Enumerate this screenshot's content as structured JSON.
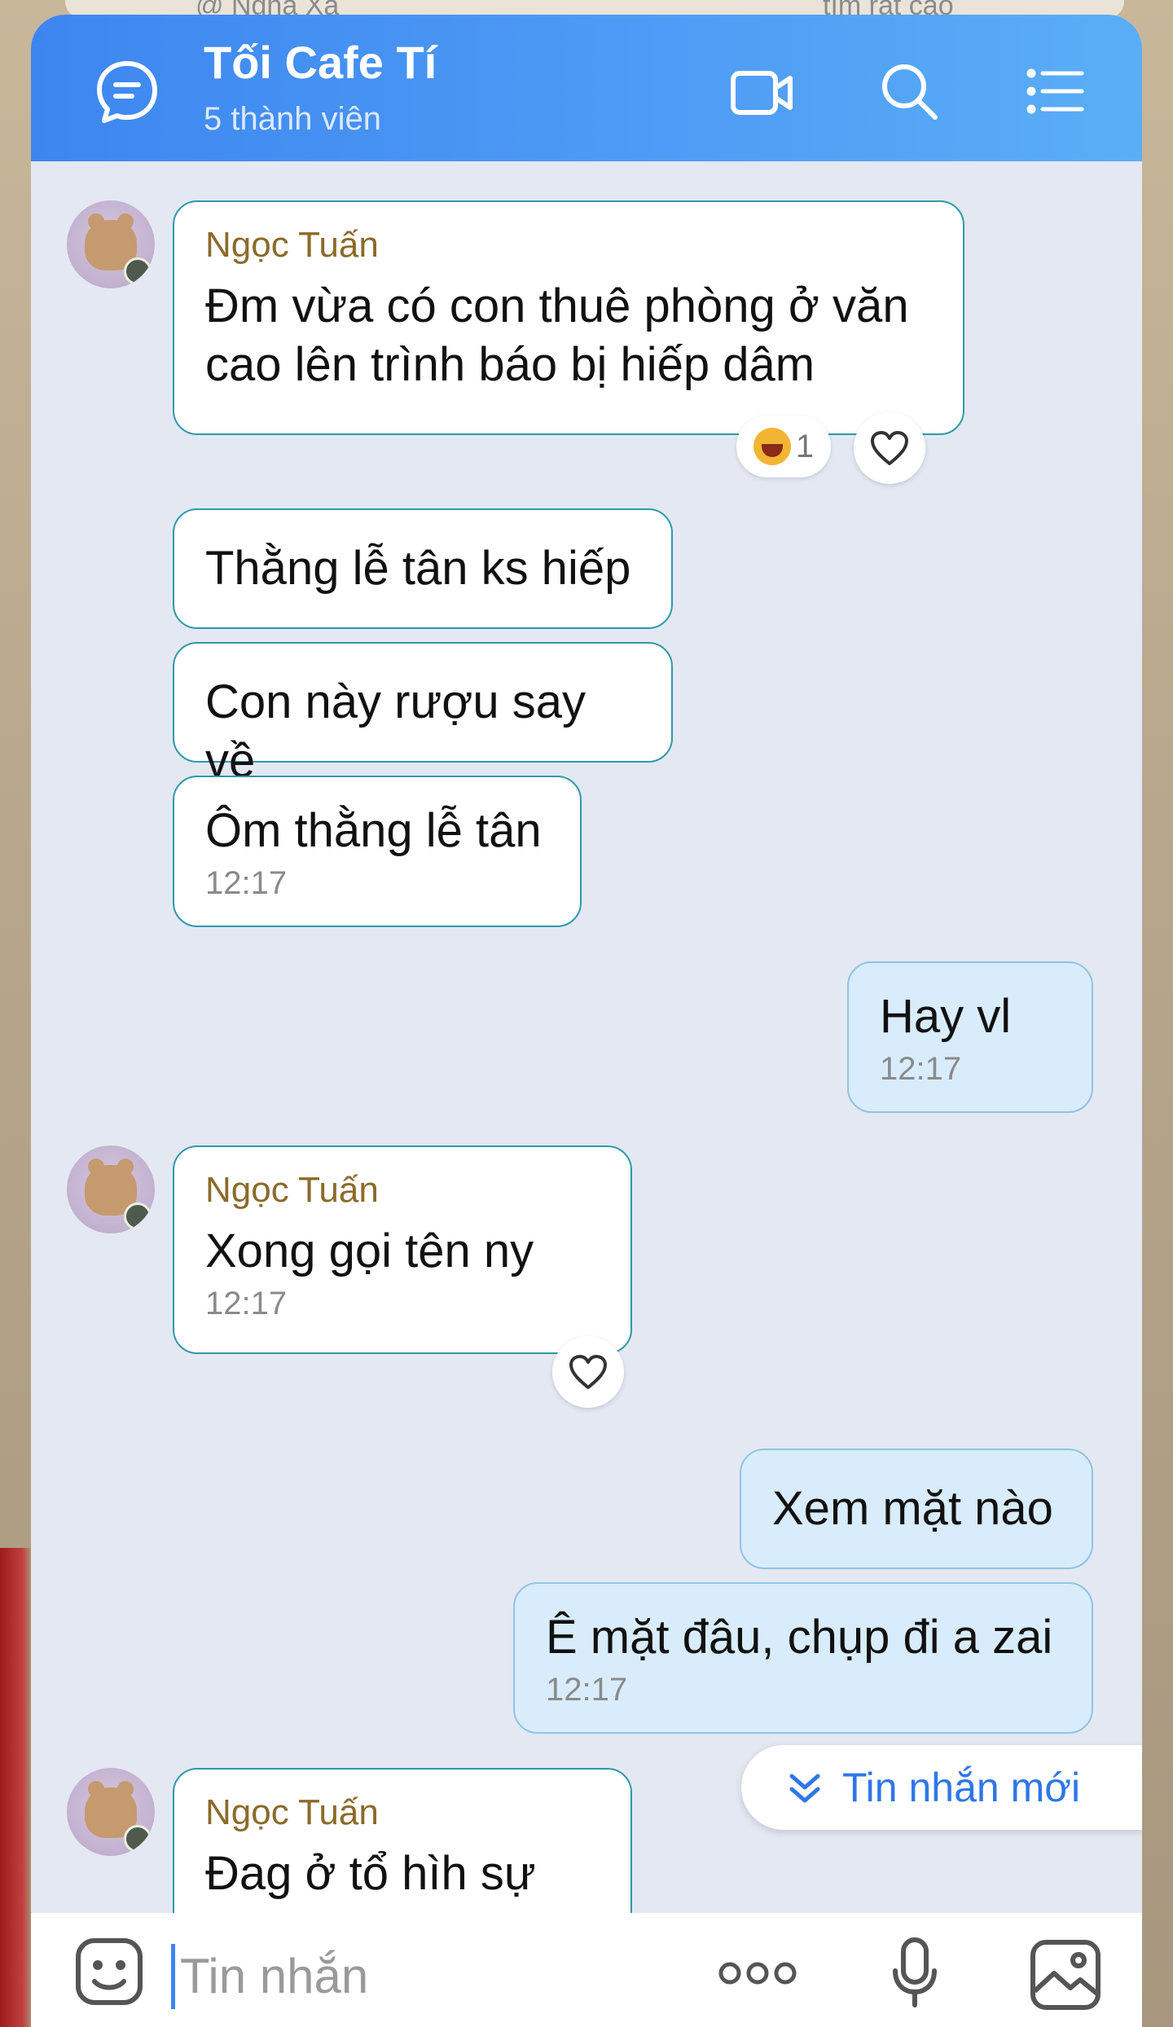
{
  "background": {
    "peek_left": "@ Nghã Xá",
    "peek_right": "tìm rất cao"
  },
  "header": {
    "title": "Tối Cafe Tí",
    "subtitle": "5 thành viên",
    "icons": [
      "chat-group-icon",
      "video-call-icon",
      "search-icon",
      "menu-list-icon"
    ]
  },
  "messages": [
    {
      "sender": "Ngọc Tuấn",
      "text": "Đm vừa có con thuê phòng ở văn\ncao lên trình báo bị hiếp dâm",
      "reaction_count": "1"
    },
    {
      "text": "Thằng lễ tân ks hiếp"
    },
    {
      "text": "Con này rượu say về"
    },
    {
      "text": "Ôm thằng lễ tân",
      "time": "12:17"
    },
    {
      "text": "Hay vl",
      "time": "12:17"
    },
    {
      "sender": "Ngọc Tuấn",
      "text": "Xong gọi tên ny",
      "time": "12:17"
    },
    {
      "text": "Xem mặt nào"
    },
    {
      "text": "Ê mặt đâu, chụp đi a zai",
      "time": "12:17"
    },
    {
      "sender": "Ngọc Tuấn",
      "text": "Đag ở tổ hìh sự"
    }
  ],
  "new_messages_label": "Tin nhắn mới",
  "composer": {
    "placeholder": "Tin nhắn"
  }
}
